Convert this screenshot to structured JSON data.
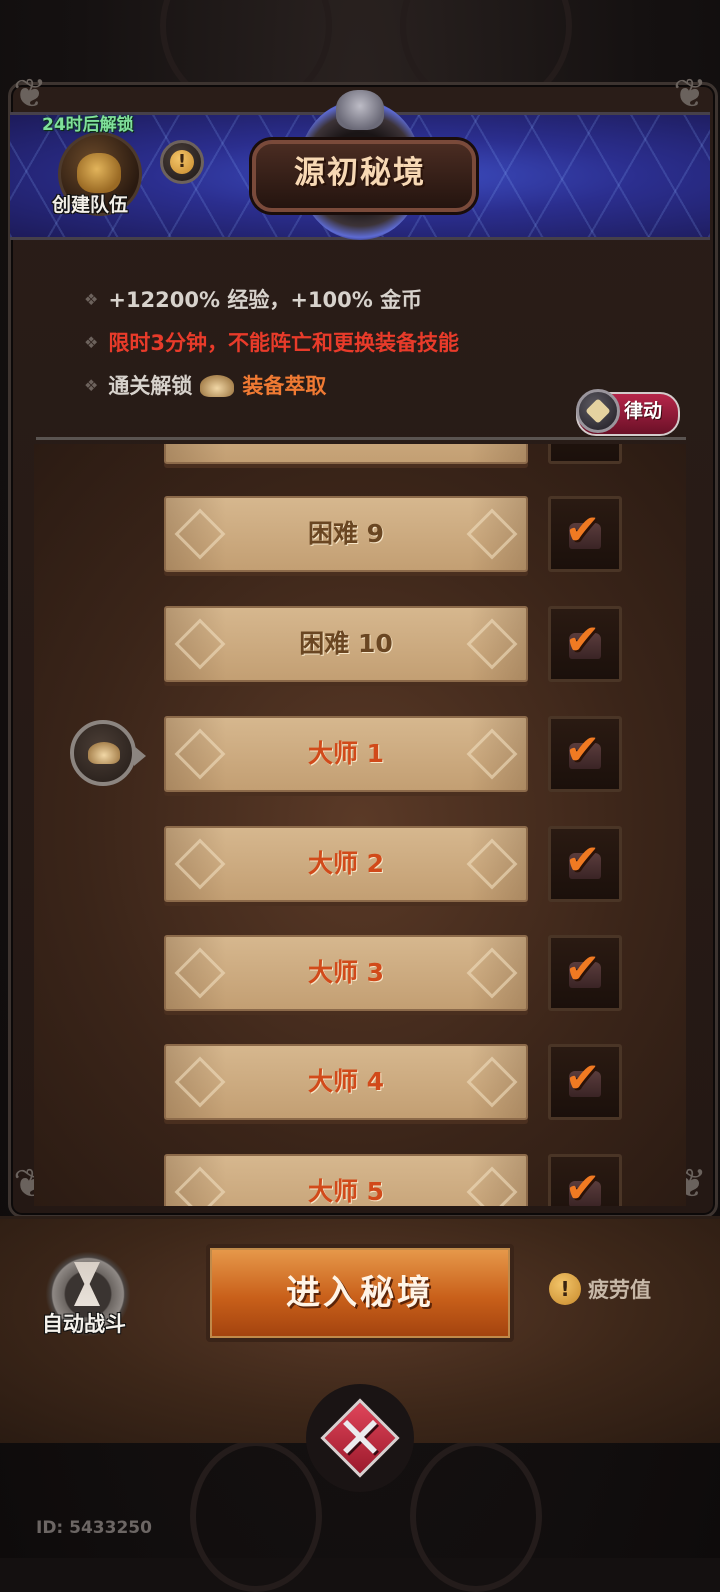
{
  "header": {
    "unlock_text": "24时后解锁",
    "create_team_label": "创建队伍",
    "title": "源初秘境"
  },
  "rules": {
    "bonus": "+12200% 经验，+100% 金币",
    "restriction": "限时3分钟，不能阵亡和更换装备技能",
    "unlock_prefix": "通关解锁",
    "unlock_reward": "装备萃取"
  },
  "rhythm_button": {
    "label": "律动"
  },
  "levels": [
    {
      "label": "困难 9",
      "tier": "hard",
      "cleared": true
    },
    {
      "label": "困难 10",
      "tier": "hard",
      "cleared": true
    },
    {
      "label": "大师 1",
      "tier": "master",
      "cleared": true,
      "current": true
    },
    {
      "label": "大师 2",
      "tier": "master",
      "cleared": true
    },
    {
      "label": "大师 3",
      "tier": "master",
      "cleared": true
    },
    {
      "label": "大师 4",
      "tier": "master",
      "cleared": true
    },
    {
      "label": "大师 5",
      "tier": "master",
      "cleared": true
    }
  ],
  "footer": {
    "auto_battle_label": "自动战斗",
    "enter_button_label": "进入秘境",
    "fatigue_label": "疲劳值"
  },
  "player_id": "ID: 5433250",
  "icons": {
    "team": "helmet-icon",
    "info": "info-icon",
    "reward": "hat-icon",
    "rhythm": "wolf-icon",
    "checked": "check-icon",
    "close": "close-icon",
    "auto_battle": "hourglass-gear-icon"
  },
  "colors": {
    "accent_orange": "#f07a33",
    "warning_red": "#e83b2a",
    "unlock_green": "#7fe09a",
    "hard_label": "#6a4622",
    "master_label": "#d14a1a"
  }
}
